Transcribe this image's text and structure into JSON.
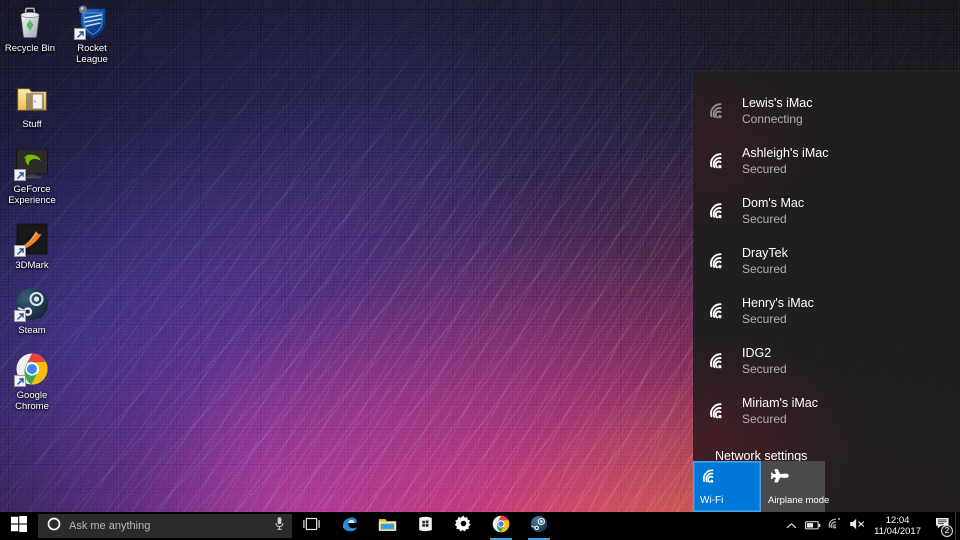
{
  "desktop": {
    "wallpaper_name": "fiber-optic-streaks-wallpaper",
    "icons": [
      {
        "label": "Recycle Bin",
        "name": "desktop-icon-recycle-bin",
        "art": "recycle-bin-icon",
        "shortcut": false
      },
      {
        "label": "Rocket League",
        "name": "desktop-icon-rocket-league",
        "art": "rocket-league-icon",
        "shortcut": true
      },
      {
        "label": "Stuff",
        "name": "desktop-icon-stuff",
        "art": "folder-icon",
        "shortcut": false
      },
      {
        "label": "GeForce Experience",
        "name": "desktop-icon-geforce-experience",
        "art": "geforce-experience-icon",
        "shortcut": true
      },
      {
        "label": "3DMark",
        "name": "desktop-icon-3dmark",
        "art": "3dmark-icon",
        "shortcut": true
      },
      {
        "label": "Steam",
        "name": "desktop-icon-steam",
        "art": "steam-icon",
        "shortcut": true
      },
      {
        "label": "Google Chrome",
        "name": "desktop-icon-google-chrome",
        "art": "chrome-icon",
        "shortcut": true
      }
    ]
  },
  "wifi_flyout": {
    "networks": [
      {
        "ssid": "Lewis's iMac",
        "status": "Connecting",
        "icon": "wifi-signal-icon",
        "connecting": true
      },
      {
        "ssid": "Ashleigh's iMac",
        "status": "Secured",
        "icon": "wifi-signal-icon",
        "connecting": false
      },
      {
        "ssid": "Dom's Mac",
        "status": "Secured",
        "icon": "wifi-signal-icon",
        "connecting": false
      },
      {
        "ssid": "DrayTek",
        "status": "Secured",
        "icon": "wifi-signal-icon",
        "connecting": false
      },
      {
        "ssid": "Henry's iMac",
        "status": "Secured",
        "icon": "wifi-signal-icon",
        "connecting": false
      },
      {
        "ssid": "IDG2",
        "status": "Secured",
        "icon": "wifi-signal-icon",
        "connecting": false
      },
      {
        "ssid": "Miriam's iMac",
        "status": "Secured",
        "icon": "wifi-signal-icon",
        "connecting": false
      }
    ],
    "settings_link": "Network settings",
    "tiles": [
      {
        "label": "Wi-Fi",
        "state": "on",
        "icon": "wifi-tile-icon",
        "name": "quick-tile-wifi"
      },
      {
        "label": "Airplane mode",
        "state": "off",
        "icon": "airplane-tile-icon",
        "name": "quick-tile-airplane-mode"
      }
    ],
    "accent_color": "#0078d7",
    "tile_off_color": "#4b4b4b",
    "panel_color": "#1e1e1e"
  },
  "taskbar": {
    "start_icon": "windows-logo-icon",
    "search": {
      "placeholder": "Ask me anything",
      "cortana_icon": "cortana-circle-icon",
      "mic_icon": "microphone-icon"
    },
    "buttons": [
      {
        "name": "taskbar-task-view",
        "icon": "task-view-icon",
        "label": "Task View",
        "running": false
      },
      {
        "name": "taskbar-microsoft-edge",
        "icon": "edge-icon",
        "label": "Microsoft Edge",
        "running": false
      },
      {
        "name": "taskbar-file-explorer",
        "icon": "file-explorer-icon",
        "label": "File Explorer",
        "running": false
      },
      {
        "name": "taskbar-microsoft-store",
        "icon": "store-icon",
        "label": "Store",
        "running": false
      },
      {
        "name": "taskbar-settings",
        "icon": "gear-icon",
        "label": "Settings",
        "running": false
      },
      {
        "name": "taskbar-google-chrome",
        "icon": "chrome-icon",
        "label": "Google Chrome",
        "running": true
      },
      {
        "name": "taskbar-steam",
        "icon": "steam-icon",
        "label": "Steam",
        "running": true
      }
    ],
    "tray": {
      "icons": [
        {
          "name": "show-hidden-icons-chevron",
          "icon": "chevron-up-icon"
        },
        {
          "name": "tray-battery",
          "icon": "battery-icon"
        },
        {
          "name": "tray-network",
          "icon": "wifi-connecting-icon"
        },
        {
          "name": "tray-volume",
          "icon": "speaker-muted-icon"
        }
      ],
      "time": "12:04",
      "date": "11/04/2017",
      "action_center_icon": "action-center-icon",
      "notification_count": "2"
    }
  }
}
